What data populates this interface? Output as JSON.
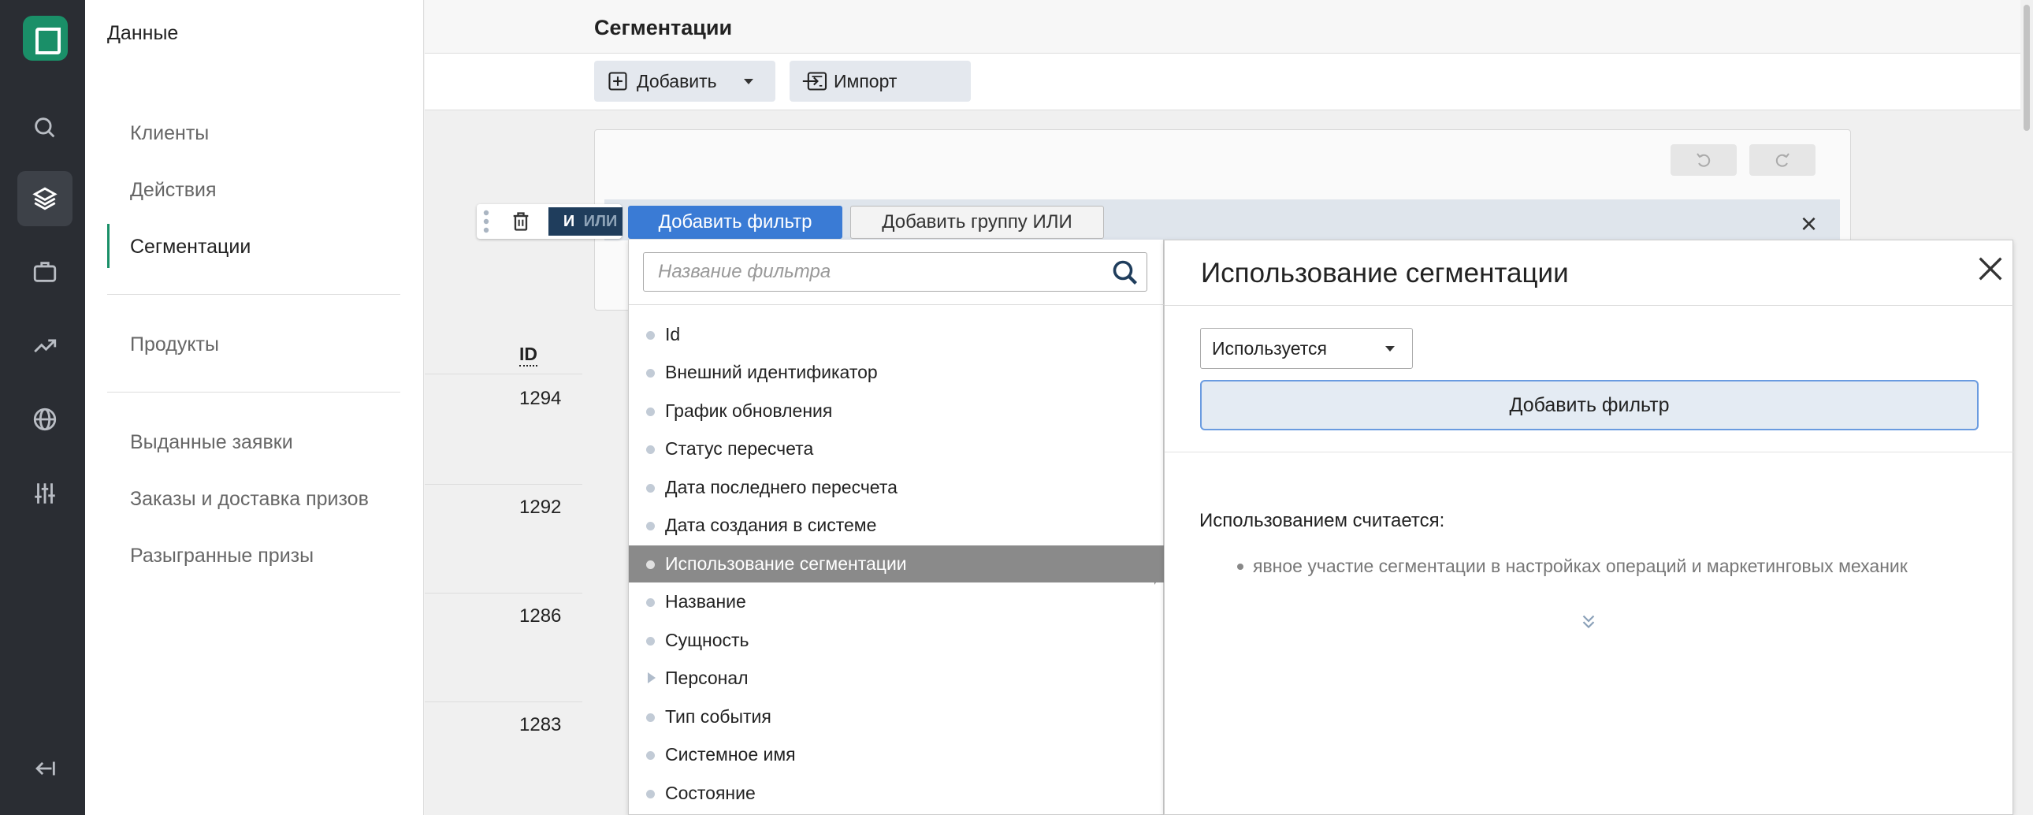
{
  "sidebar": {
    "title": "Данные",
    "items": [
      {
        "label": "Клиенты"
      },
      {
        "label": "Действия"
      },
      {
        "label": "Сегментации"
      },
      {
        "label": "Продукты"
      },
      {
        "label": "Выданные заявки"
      },
      {
        "label": "Заказы и доставка призов"
      },
      {
        "label": "Разыгранные призы"
      }
    ],
    "active": "Сегментации"
  },
  "header": {
    "title": "Сегментации"
  },
  "toolbar": {
    "add_label": "Добавить",
    "import_label": "Импорт"
  },
  "group": {
    "and_label": "И",
    "or_label": "ИЛИ",
    "add_filter_label": "Добавить фильтр",
    "add_or_group_label": "Добавить группу ИЛИ"
  },
  "table": {
    "id_header": "ID",
    "rows": [
      {
        "id": "1294"
      },
      {
        "id": "1292"
      },
      {
        "id": "1286"
      },
      {
        "id": "1283"
      }
    ]
  },
  "filter_list": {
    "search_placeholder": "Название фильтра",
    "items": [
      {
        "label": "Id"
      },
      {
        "label": "Внешний идентификатор"
      },
      {
        "label": "График обновления"
      },
      {
        "label": "Статус пересчета"
      },
      {
        "label": "Дата последнего пересчета"
      },
      {
        "label": "Дата создания в системе"
      },
      {
        "label": "Использование сегментации"
      },
      {
        "label": "Название"
      },
      {
        "label": "Сущность"
      },
      {
        "label": "Персонал"
      },
      {
        "label": "Тип события"
      },
      {
        "label": "Системное имя"
      },
      {
        "label": "Состояние"
      }
    ],
    "selected": "Использование сегментации"
  },
  "detail": {
    "title": "Использование сегментации",
    "select_value": "Используется",
    "add_filter_label": "Добавить фильтр",
    "usage_label": "Использованием считается:",
    "usage_items": [
      "явное участие сегментации в настройках операций и маркетинговых механик"
    ]
  },
  "colors": {
    "brand": "#1a8f68",
    "primary_button": "#3a7bd5",
    "group_toggle": "#1f3d5c",
    "selected_item": "#8a8a8a"
  }
}
